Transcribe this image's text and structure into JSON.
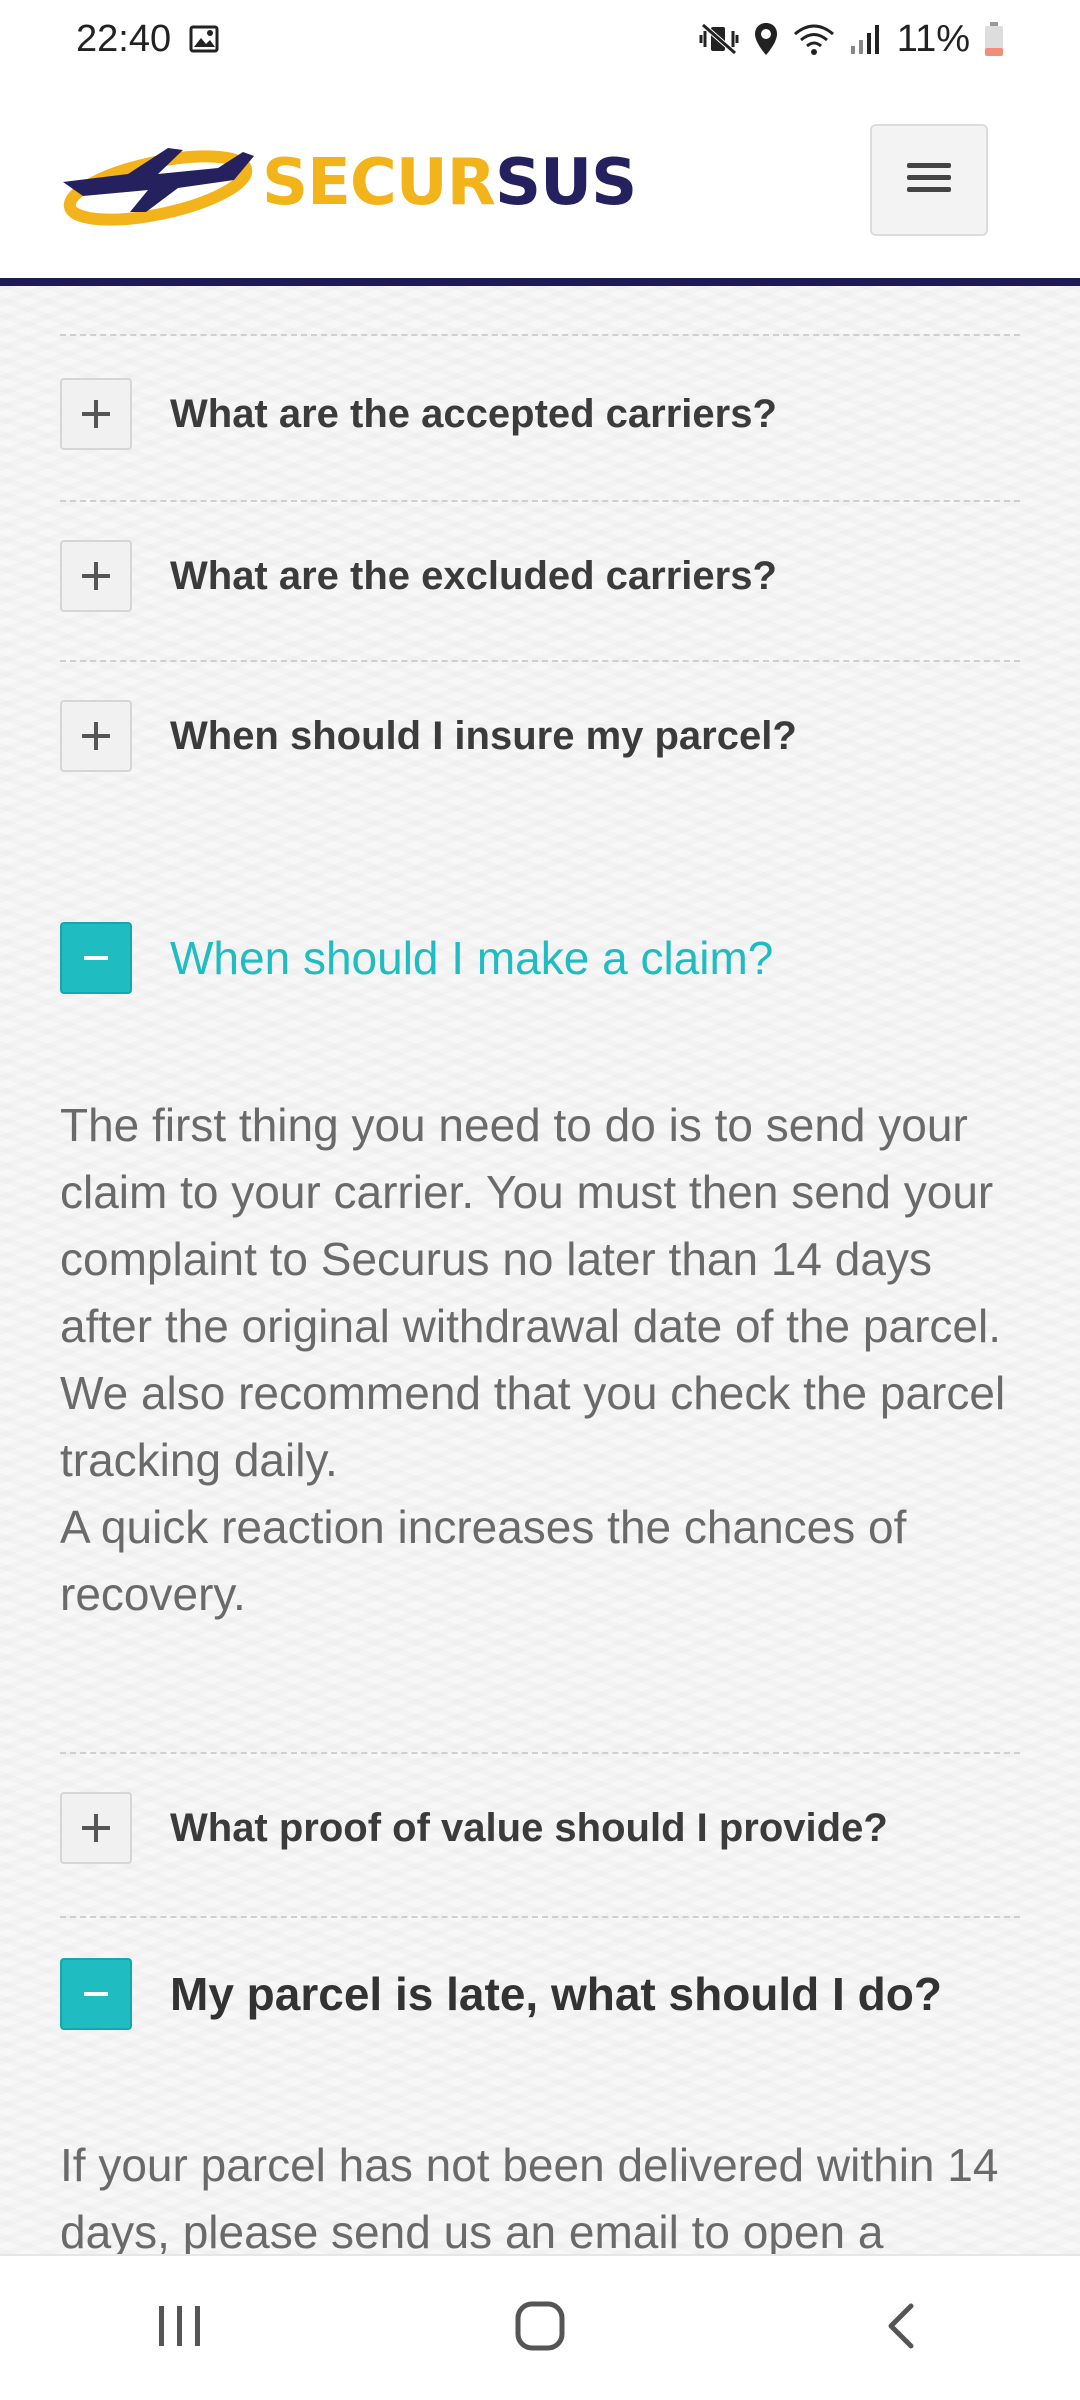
{
  "status_bar": {
    "time": "22:40",
    "battery": "11%",
    "icons": [
      "gallery-icon",
      "mute-vibrate-icon",
      "location-icon",
      "wifi-icon",
      "signal-icon",
      "battery-icon"
    ]
  },
  "header": {
    "logo_part1": "SECUR",
    "logo_part2": "SUS",
    "menu_icon": "hamburger-icon",
    "brand_colors": {
      "yellow": "#f3b41b",
      "navy": "#25205e"
    }
  },
  "faq": {
    "accent_color": "#1fbcc1",
    "items": [
      {
        "question": "What are the accepted carriers?",
        "expanded": false
      },
      {
        "question": "What are the excluded carriers?",
        "expanded": false
      },
      {
        "question": "When should I insure my parcel?",
        "expanded": false
      },
      {
        "question": "When should I make a claim?",
        "expanded": true,
        "answer": [
          "The first thing you need to do is to send your claim to your carrier. You must then send your complaint to Securus no later than 14 days after the original withdrawal date of the parcel.",
          "We also recommend that you check the parcel tracking daily.",
          "A quick reaction increases the chances of recovery."
        ]
      },
      {
        "question": "What proof of value should I provide?",
        "expanded": false
      },
      {
        "question": "My parcel is late, what should I do?",
        "expanded": true,
        "answer": [
          "If your parcel has not been delivered within 14 days, please send us an email to open a"
        ]
      }
    ]
  },
  "nav_bar": {
    "buttons": [
      "recent-apps-icon",
      "home-icon",
      "back-icon"
    ]
  }
}
